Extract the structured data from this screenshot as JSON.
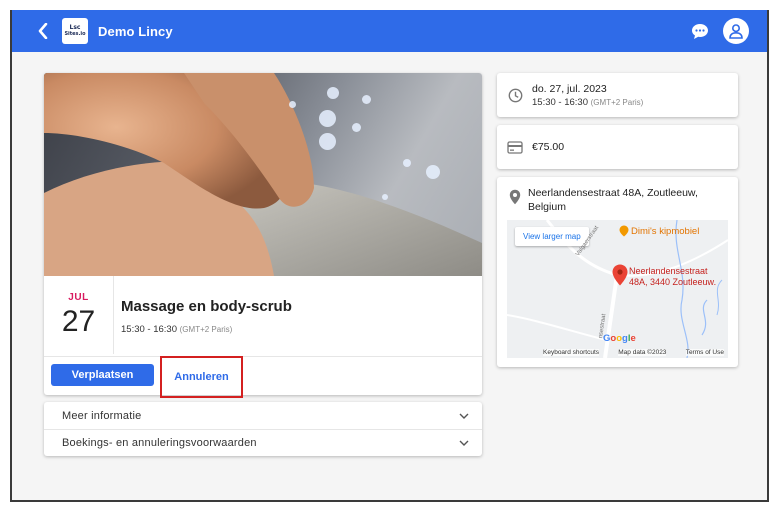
{
  "header": {
    "logo_line1": "Lsc",
    "logo_line2": "Sites.io",
    "title": "Demo Lincy",
    "bg_color": "#2f6be8"
  },
  "event": {
    "month": "JUL",
    "day": "27",
    "title": "Massage en body-scrub",
    "time": "15:30 - 16:30",
    "timezone": "(GMT+2 Paris)"
  },
  "actions": {
    "reschedule_label": "Verplaatsen",
    "cancel_label": "Annuleren"
  },
  "accordion": [
    {
      "label": "Meer informatie"
    },
    {
      "label": "Boekings- en annuleringsvoorwaarden"
    }
  ],
  "details": {
    "date": "do. 27, jul. 2023",
    "time": "15:30 - 16:30",
    "timezone": "(GMT+2 Paris)",
    "price": "€75.00",
    "address": "Neerlandensestraat 48A, Zoutleeuw, Belgium"
  },
  "map": {
    "view_larger": "View larger map",
    "poi": "Dimi's kipmobiel",
    "pin_label_line1": "Neerlandensestraat",
    "pin_label_line2": "48A, 3440 Zoutleeuw.",
    "street_a": "Valgaerstraat",
    "street_b": "nsestraat",
    "google_logo": "Google",
    "attrib_shortcuts": "Keyboard shortcuts",
    "attrib_data": "Map data ©2023",
    "attrib_terms": "Terms of Use"
  }
}
